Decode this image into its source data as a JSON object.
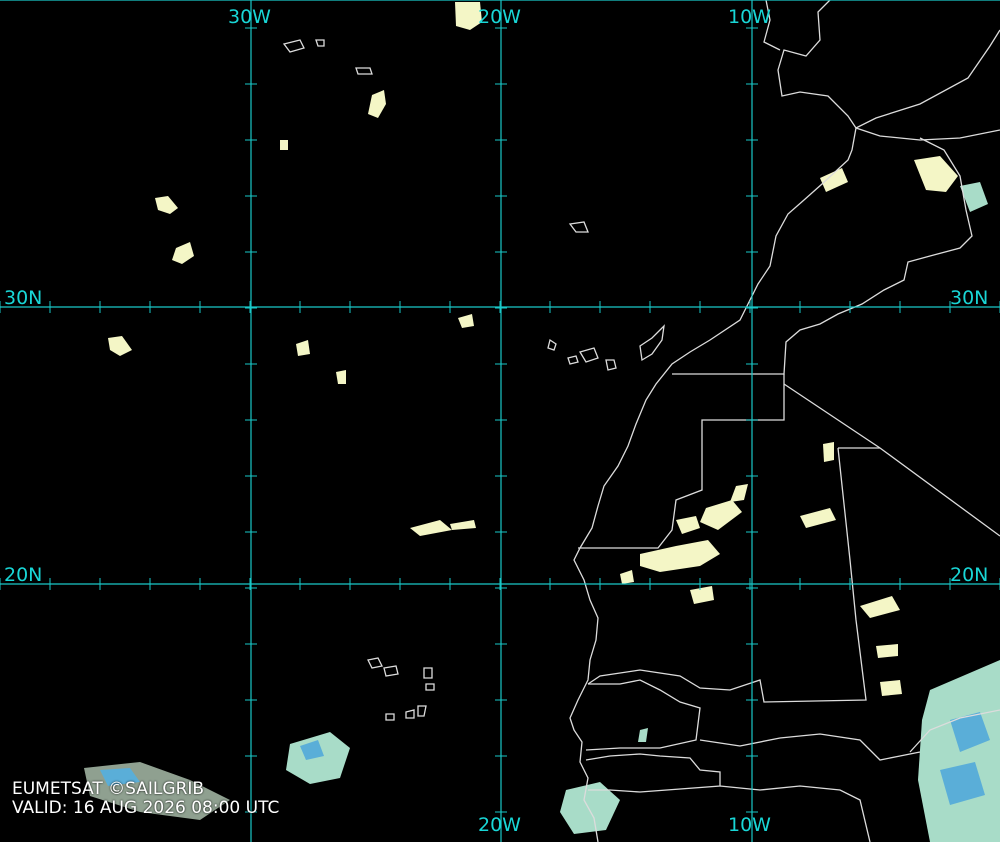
{
  "map": {
    "lon_labels": [
      "30W",
      "20W",
      "10W"
    ],
    "lat_labels": [
      "30N",
      "20N"
    ],
    "credit": "EUMETSAT ©SAILGRIB",
    "valid": "VALID:  16 AUG 2026 08:00 UTC",
    "colors": {
      "background": "#000000",
      "grid": "#19c8c8",
      "coast": "#dcdcdc",
      "cloud_low": "#f4f6c6",
      "cloud_mid": "#a8dcc8",
      "cloud_high": "#5aaed8"
    }
  }
}
